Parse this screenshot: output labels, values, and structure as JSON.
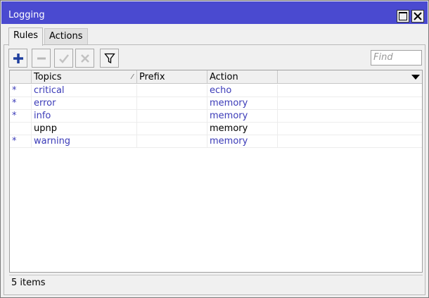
{
  "window": {
    "title": "Logging"
  },
  "tabs": [
    {
      "label": "Rules",
      "active": true
    },
    {
      "label": "Actions",
      "active": false
    }
  ],
  "toolbar": {
    "find_placeholder": "Find"
  },
  "table": {
    "columns": [
      {
        "label": "",
        "key": "flag"
      },
      {
        "label": "Topics",
        "key": "topics"
      },
      {
        "label": "Prefix",
        "key": "prefix"
      },
      {
        "label": "Action",
        "key": "action"
      }
    ],
    "rows": [
      {
        "flag": "*",
        "topics": "critical",
        "prefix": "",
        "action": "echo",
        "dynamic": true
      },
      {
        "flag": "*",
        "topics": "error",
        "prefix": "",
        "action": "memory",
        "dynamic": true
      },
      {
        "flag": "*",
        "topics": "info",
        "prefix": "",
        "action": "memory",
        "dynamic": true
      },
      {
        "flag": "",
        "topics": "upnp",
        "prefix": "",
        "action": "memory",
        "dynamic": false
      },
      {
        "flag": "*",
        "topics": "warning",
        "prefix": "",
        "action": "memory",
        "dynamic": true
      }
    ]
  },
  "status": {
    "count_text": "5 items"
  },
  "colors": {
    "titlebar": "#4a4ad0",
    "dynamic_text": "#3b3bb8",
    "add_icon": "#1f3f9e"
  },
  "icons": {
    "add": "plus-icon",
    "remove": "minus-icon",
    "enable": "check-icon",
    "disable": "x-icon",
    "filter": "funnel-icon",
    "maximize": "maximize-icon",
    "close": "close-icon",
    "column_menu": "triangle-down-icon"
  }
}
